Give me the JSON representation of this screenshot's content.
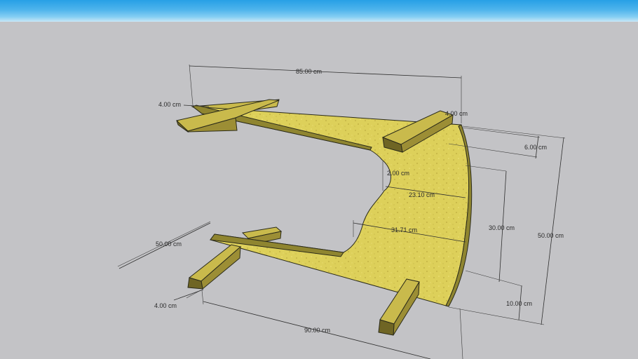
{
  "viewport": {
    "sky_color": "#4eb4ec",
    "ground_color": "#c3c3c6",
    "material_color": "#ddd05a"
  },
  "dimensions": {
    "top_length": "85.00 cm",
    "batten_width_top": "4.00 cm",
    "batten_width_top_right": "4.00 cm",
    "top_thickness": "6.00 cm",
    "notch_radius": "2.00 cm",
    "inner_top_depth": "23.10 cm",
    "inner_bottom_depth": "31.71 cm",
    "inner_height": "30.00 cm",
    "total_height": "50.00 cm",
    "base_depth": "50.00 cm",
    "base_thickness": "10.00 cm",
    "batten_width_bottom": "4.00 cm",
    "base_length": "90.00 cm"
  }
}
